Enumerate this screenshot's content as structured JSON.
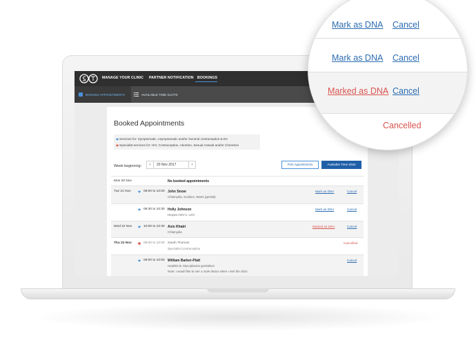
{
  "nav": {
    "items": [
      "MANAGE YOUR CLINIC",
      "PARTNER NOTIFICATION",
      "BOOKINGS"
    ]
  },
  "subnav": {
    "booked": "BOOKED APPOINTMENTS",
    "available": "AVAILABLE TIME SLOTS"
  },
  "page": {
    "title": "Booked Appointments",
    "legend": [
      "Services for: Symptomatic, Asymptomatic and/or General contraception & EC",
      "Specialist services for: HIV, Contraception, Abortion, Sexual Assault and/or ChemSex"
    ],
    "week_label": "Week beginning:",
    "week_value": "20 Nov 2017",
    "print_button": "Print Appointments",
    "available_button": "Available Time Slots"
  },
  "appointments": [
    {
      "day": "Mon 20 Nov",
      "time": "",
      "name": "No booked appointments",
      "detail": "",
      "note": "",
      "dna": "",
      "cancel": "",
      "status": ""
    },
    {
      "day": "Tue 21 Nov",
      "time": "09:00 to 10:00",
      "name": "John Snow",
      "detail": "Chlamydia, Scabies, Warts (genital)",
      "note": "",
      "dna": "Mark as DNA",
      "cancel": "Cancel",
      "status": ""
    },
    {
      "day": "",
      "time": "09:30 to 10:30",
      "name": "Holly Johnson",
      "detail": "Herpes HSV-1, LGV",
      "note": "",
      "dna": "Mark as DNA",
      "cancel": "Cancel",
      "status": ""
    },
    {
      "day": "Wed 22 Nov",
      "time": "10:00 to 10:30",
      "name": "Asis Khatri",
      "detail": "Chlamydia",
      "note": "",
      "dna": "Marked as DNA",
      "cancel": "Cancel",
      "status": ""
    },
    {
      "day": "Thu 23 Nov",
      "time": "09:00 to 10:00",
      "name": "Sarah Thomas",
      "detail": "Specialist Contraception",
      "note": "",
      "dna": "",
      "cancel": "",
      "status": "Cancelled"
    },
    {
      "day": "",
      "time": "09:00 to 10:00",
      "name": "William Barker-Platt",
      "detail": "Hepititis B, Mycoplasma genitalium",
      "note": "Note: I would like to see a male doctor when I visit the clinic.",
      "dna": "",
      "cancel": "Cancel",
      "status": ""
    }
  ],
  "magnifier": {
    "row1_dna": "Mark as DNA",
    "row1_cancel": "Cancel",
    "row2_dna": "Mark as DNA",
    "row2_cancel": "Cancel",
    "row3_dna": "Marked as DNA",
    "row3_cancel": "Cancel",
    "row4_status": "Cancelled"
  },
  "colors": {
    "nav_bg": "#2f2f2f",
    "accent_blue": "#1f5fa8",
    "link_blue": "#2b6cb0",
    "alert_red": "#d9534f"
  },
  "icons": [
    "logo-icon",
    "calendar-icon",
    "list-icon",
    "heart-icon",
    "chevron-left-icon",
    "chevron-right-icon"
  ]
}
